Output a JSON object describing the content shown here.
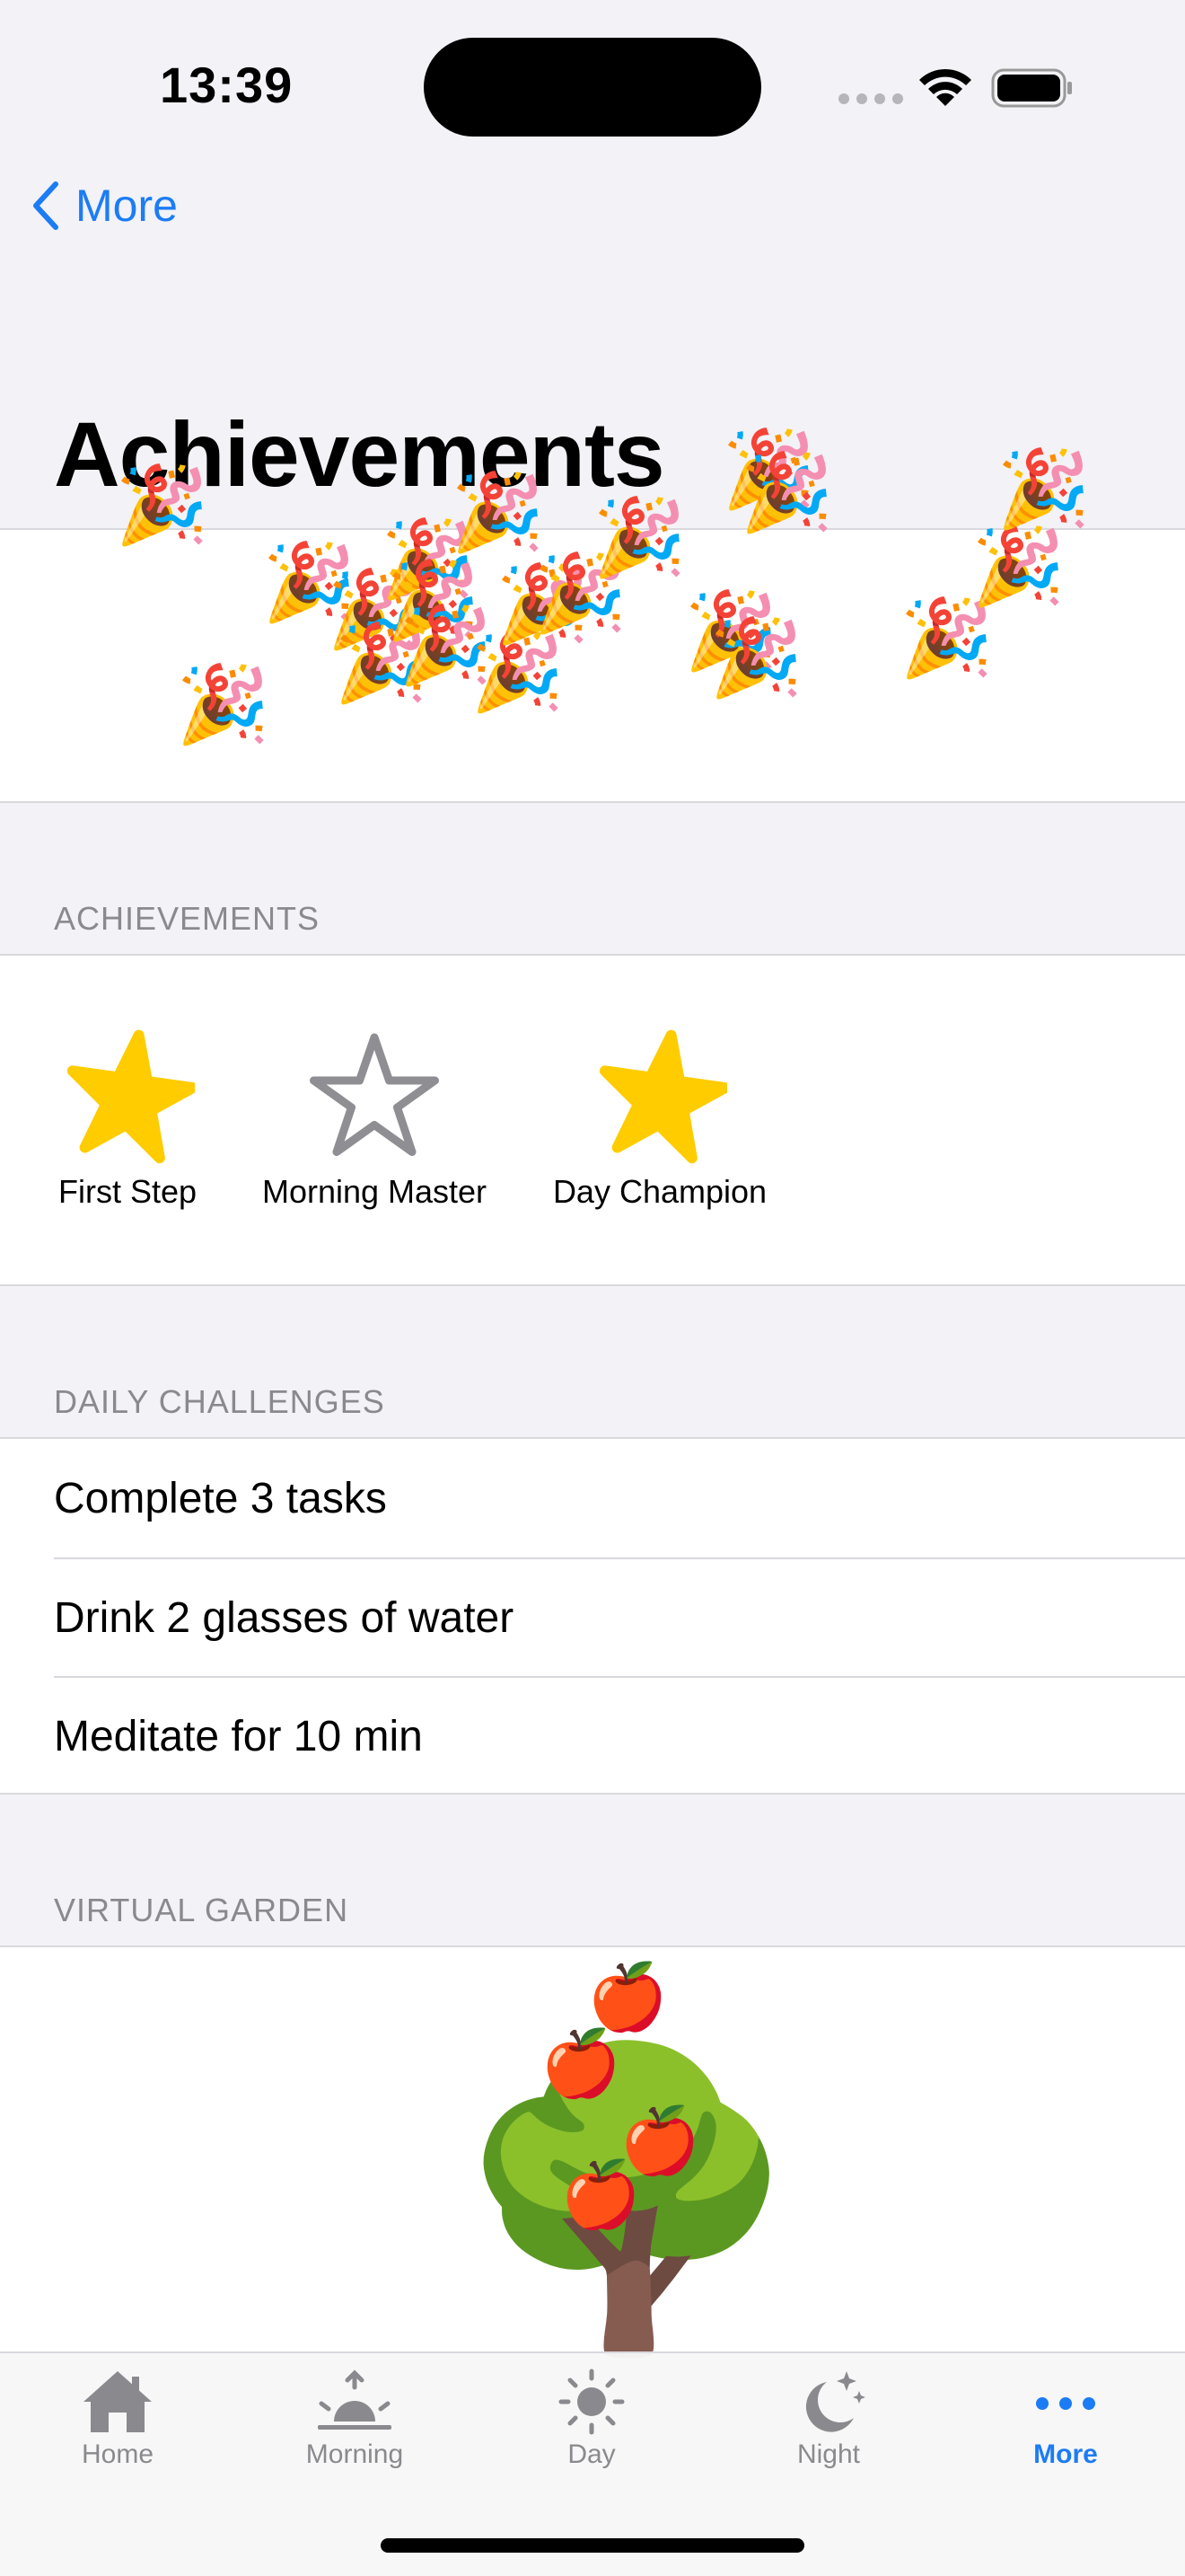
{
  "status_bar": {
    "time": "13:39"
  },
  "nav": {
    "back_label": "More",
    "title": "Achievements"
  },
  "sections": {
    "achievements_header": "ACHIEVEMENTS",
    "challenges_header": "DAILY CHALLENGES",
    "garden_header": "VIRTUAL GARDEN"
  },
  "achievements": [
    {
      "label": "First Step",
      "earned": true,
      "icon": "star-filled-icon"
    },
    {
      "label": "Morning Master",
      "earned": false,
      "icon": "star-outline-icon"
    },
    {
      "label": "Day Champion",
      "earned": true,
      "icon": "star-filled-icon"
    }
  ],
  "challenges": [
    {
      "label": "Complete 3 tasks"
    },
    {
      "label": "Drink 2 glasses of water"
    },
    {
      "label": "Meditate for 10 min"
    }
  ],
  "garden": {
    "tree": "🌳",
    "fruit": "🍎",
    "fruit_count": 4
  },
  "confetti": {
    "emoji": "🎉"
  },
  "tabs": [
    {
      "label": "Home",
      "icon": "house-icon",
      "active": false
    },
    {
      "label": "Morning",
      "icon": "sunrise-icon",
      "active": false
    },
    {
      "label": "Day",
      "icon": "sun-icon",
      "active": false
    },
    {
      "label": "Night",
      "icon": "moon-stars-icon",
      "active": false
    },
    {
      "label": "More",
      "icon": "ellipsis-icon",
      "active": true
    }
  ],
  "colors": {
    "accent": "#1c7cf4",
    "star": "#ffcc00",
    "star_outline": "#8e8e93",
    "inactive": "#8a8a8e"
  }
}
